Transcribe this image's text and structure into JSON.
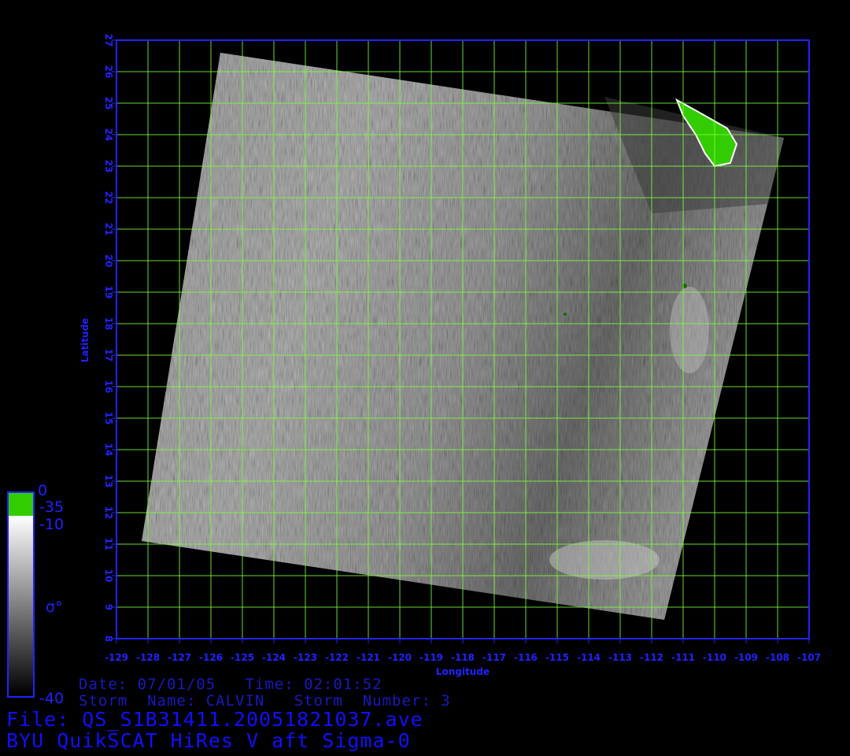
{
  "header": {
    "date_line": "Date: 07/01/05   Time: 02:01:52",
    "storm_line": "Storm  Name: CALVIN   Storm  Number: 3",
    "file_line": "File: QS_S1B31411.20051821037.ave",
    "product_line": "BYU QuikSCAT HiRes V aft Sigma-0"
  },
  "axes": {
    "xlabel": "Longitude",
    "ylabel": "Latitude",
    "x_range": [
      -129,
      -107
    ],
    "y_range": [
      8,
      27
    ],
    "x_ticks": [
      "-129",
      "-128",
      "-127",
      "-126",
      "-125",
      "-124",
      "-123",
      "-122",
      "-121",
      "-120",
      "-119",
      "-118",
      "-117",
      "-116",
      "-115",
      "-114",
      "-113",
      "-112",
      "-111",
      "-110",
      "-109",
      "-108",
      "-107"
    ],
    "y_ticks": [
      "8",
      "9",
      "10",
      "11",
      "12",
      "13",
      "14",
      "15",
      "16",
      "17",
      "18",
      "19",
      "20",
      "21",
      "22",
      "23",
      "24",
      "25",
      "26",
      "27"
    ]
  },
  "colorbar": {
    "top_label": "0",
    "land_label": "-35",
    "high_label": "-10",
    "low_label": "-40",
    "symbol": "σ°",
    "land_color": "#33cc00",
    "grid_color": "#7aff3a",
    "axis_color": "#2222ff"
  },
  "swath": {
    "corners_lonlat": [
      [
        -125.7,
        26.6
      ],
      [
        -107.8,
        23.9
      ],
      [
        -111.6,
        8.6
      ],
      [
        -128.2,
        11.1
      ]
    ]
  }
}
